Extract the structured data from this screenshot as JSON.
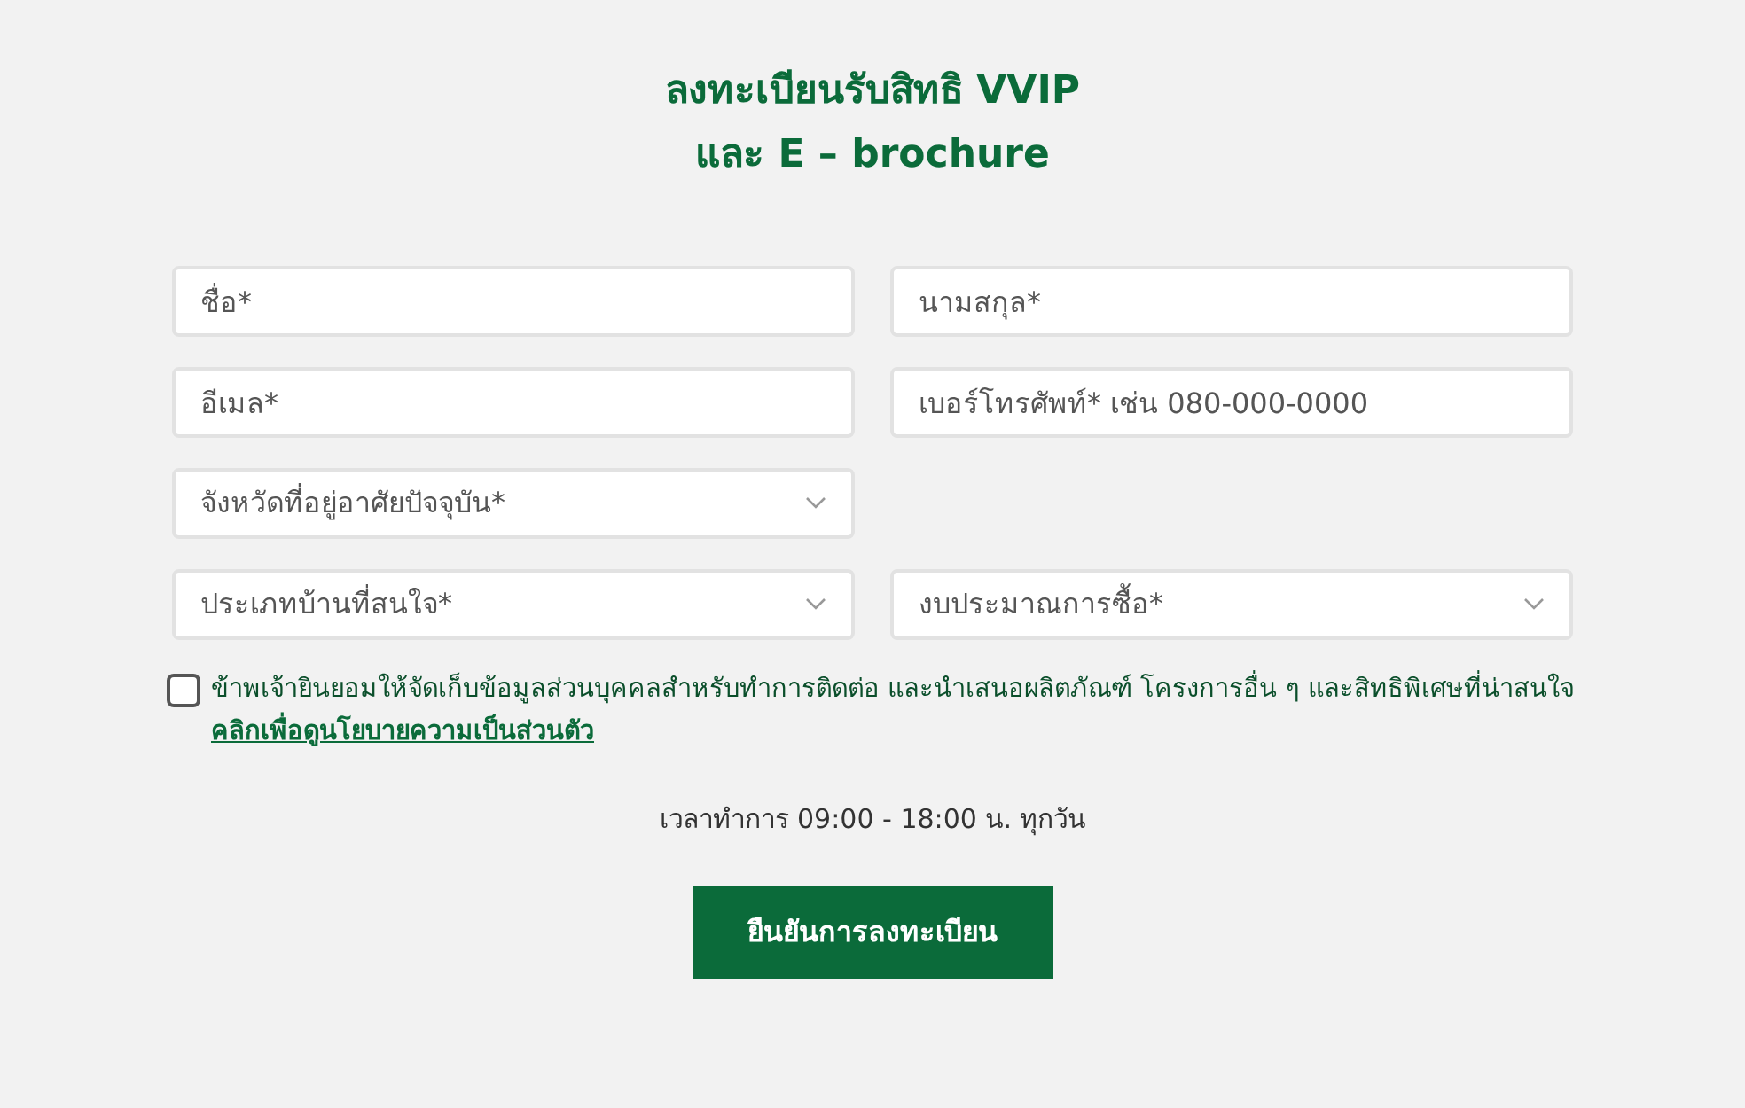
{
  "title": [
    "ลงทะเบียนรับสิทธิ VVIP",
    "และ E – brochure"
  ],
  "fields": [
    {
      "kind": "text",
      "placeholder": "ชื่อ*"
    },
    {
      "kind": "text",
      "placeholder": "นามสกุล*"
    },
    {
      "kind": "text",
      "placeholder": "อีเมล*"
    },
    {
      "kind": "text",
      "placeholder": "เบอร์โทรศัพท์* เช่น 080-000-0000"
    },
    {
      "kind": "select",
      "placeholder": "จังหวัดที่อยู่อาศัยปัจจุบัน*"
    },
    {
      "kind": "spacer"
    },
    {
      "kind": "select",
      "placeholder": "ประเภทบ้านที่สนใจ*"
    },
    {
      "kind": "select",
      "placeholder": "งบประมาณการซื้อ*"
    }
  ],
  "consent": {
    "checked": false,
    "text": "ข้าพเจ้ายินยอมให้จัดเก็บข้อมูลส่วนบุคคลสำหรับทำการติดต่อ และนำเสนอผลิตภัณฑ์ โครงการอื่น ๆ และสิทธิพิเศษที่น่าสนใจ",
    "link": "คลิกเพื่อดูนโยบายความเป็นส่วนตัว"
  },
  "hours": "เวลาทำการ 09:00 - 18:00 น. ทุกวัน",
  "submit": "ยืนยันการลงทะเบียน"
}
